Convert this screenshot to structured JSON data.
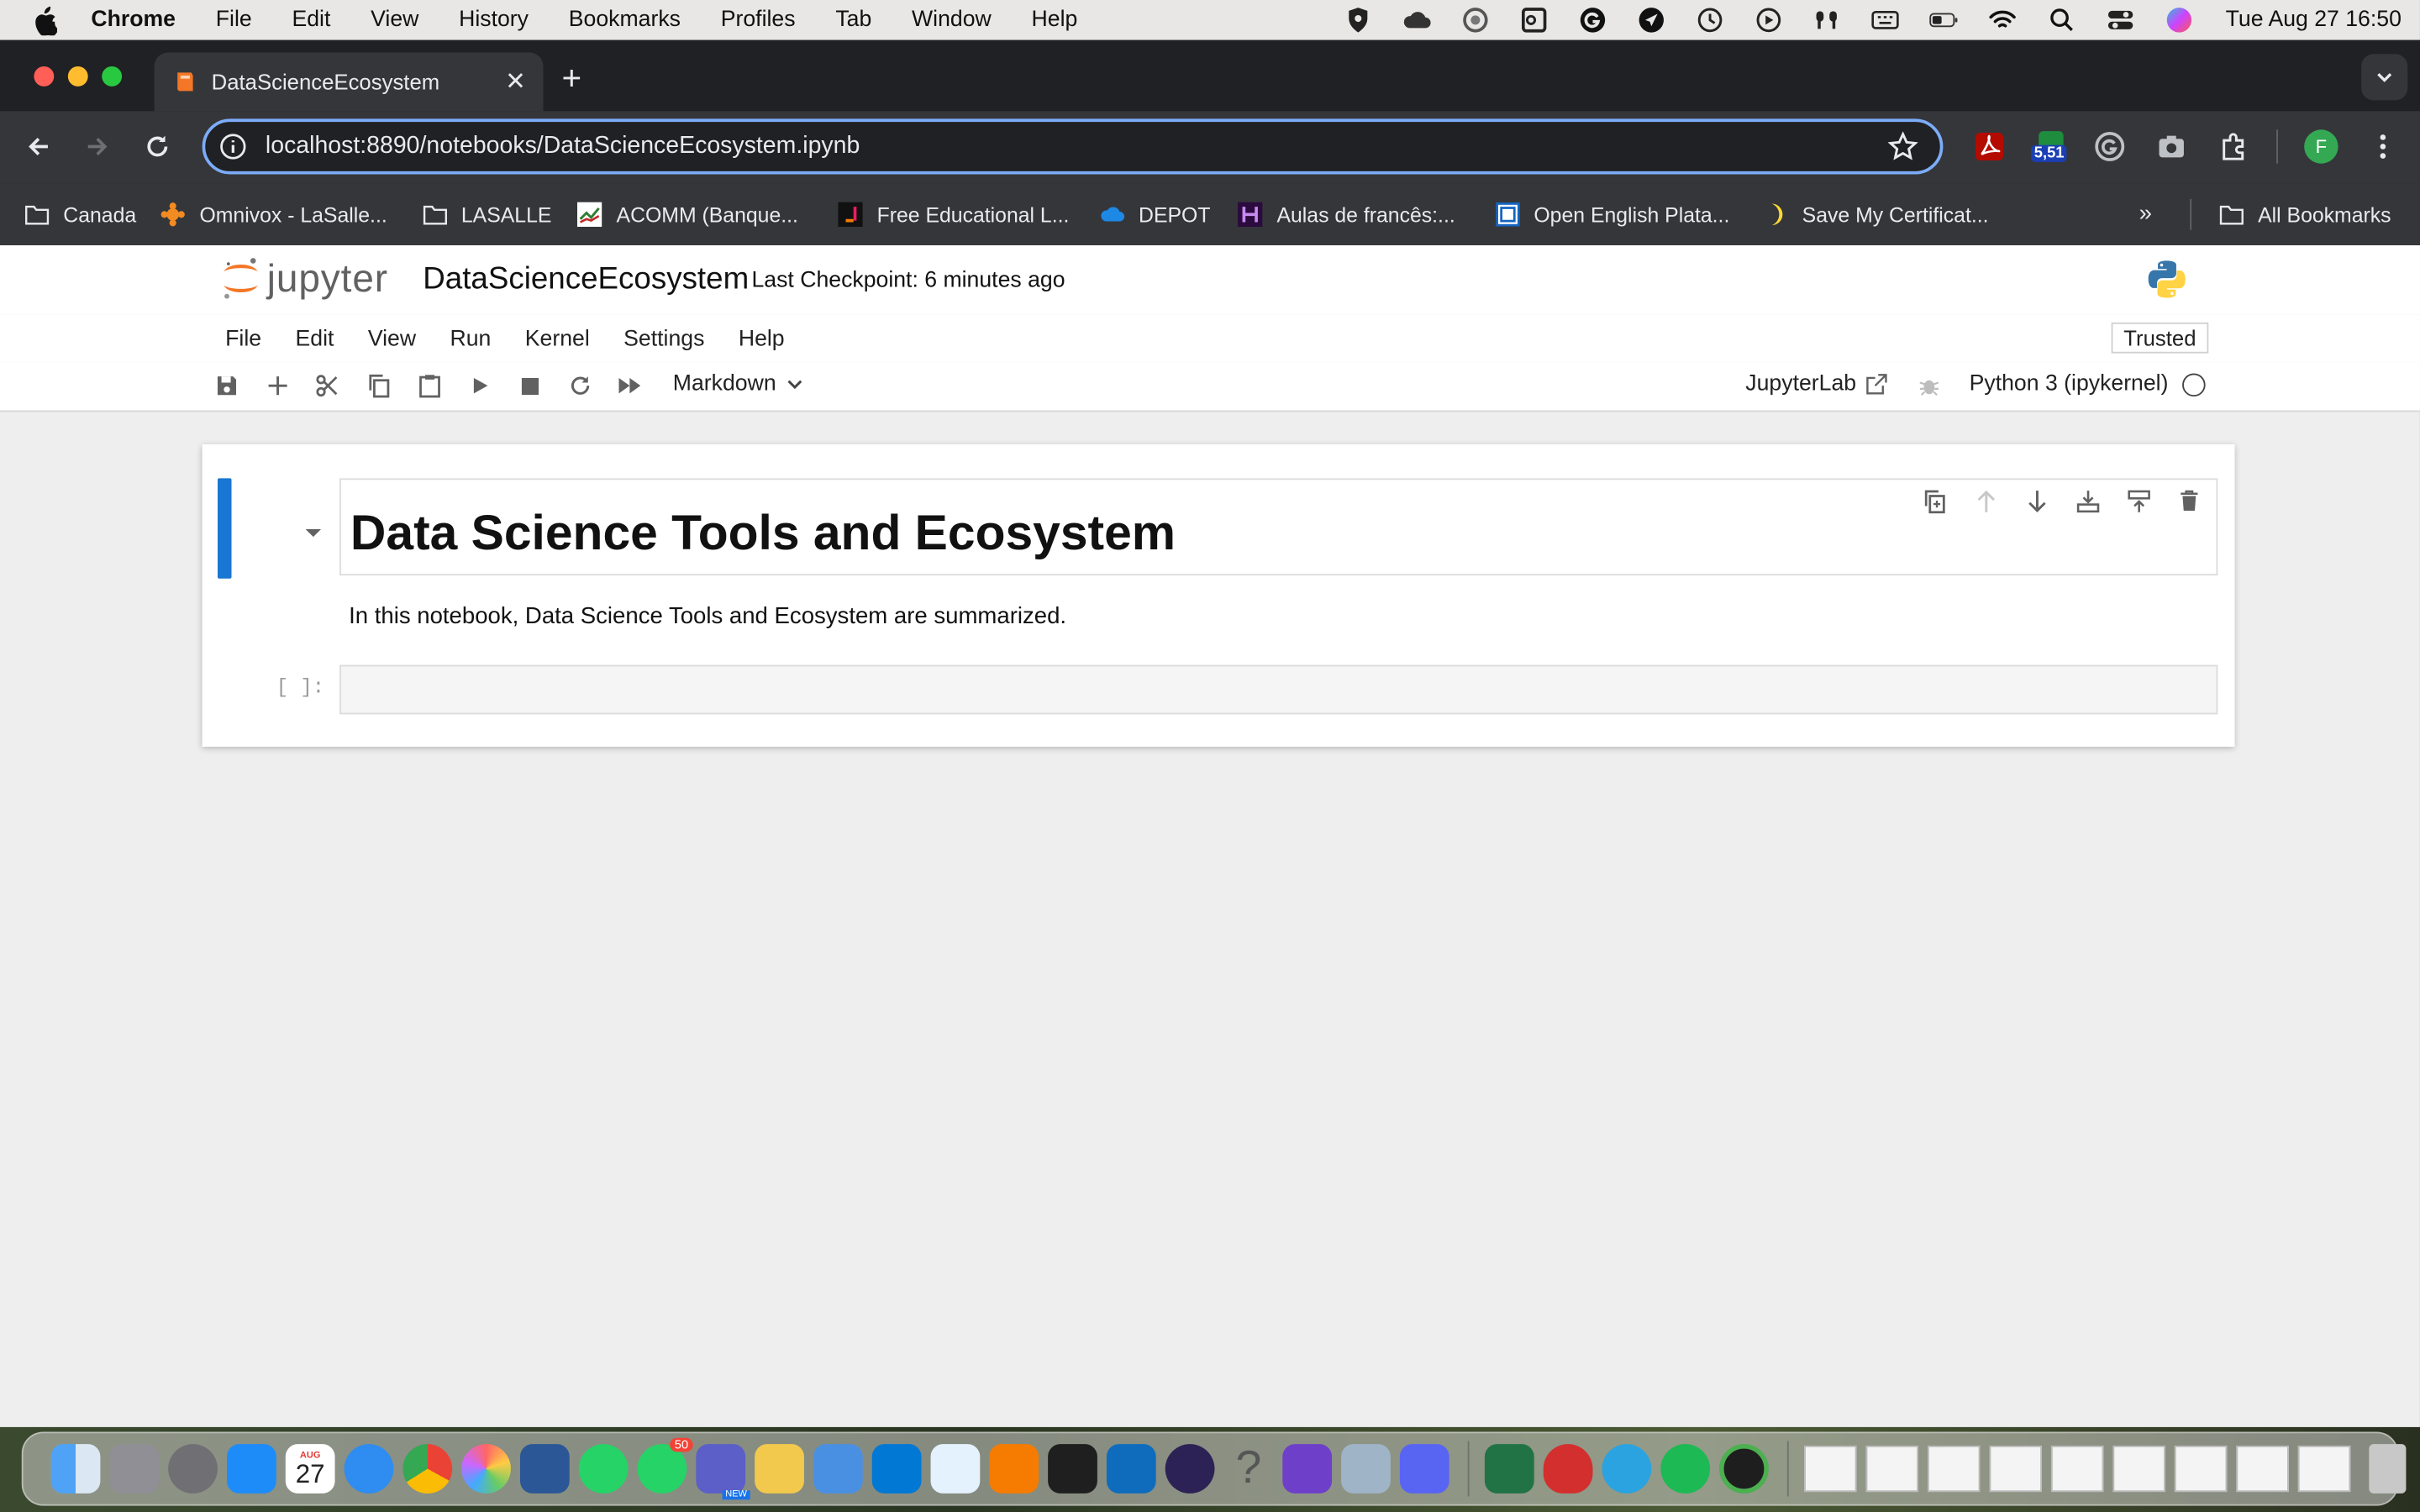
{
  "menubar": {
    "app_name": "Chrome",
    "items": [
      "File",
      "Edit",
      "View",
      "History",
      "Bookmarks",
      "Profiles",
      "Tab",
      "Window",
      "Help"
    ],
    "clock": "Tue Aug 27  16:50"
  },
  "browser": {
    "tab_title": "DataScienceEcosystem",
    "url": "localhost:8890/notebooks/DataScienceEcosystem.ipynb",
    "extension_badge": "5,51",
    "profile_initial": "F",
    "bookmarks": [
      {
        "label": "Canada",
        "icon": "folder-icon"
      },
      {
        "label": "Omnivox - LaSalle...",
        "icon": "omnivox-icon"
      },
      {
        "label": "LASALLE",
        "icon": "folder-icon"
      },
      {
        "label": "ACOMM (Banque...",
        "icon": "chart-icon"
      },
      {
        "label": "Free Educational L...",
        "icon": "edu-icon"
      },
      {
        "label": "DEPOT",
        "icon": "cloud-icon"
      },
      {
        "label": "Aulas de francês:...",
        "icon": "aulas-icon"
      },
      {
        "label": "Open English Plata...",
        "icon": "window-icon"
      },
      {
        "label": "Save My Certificat...",
        "icon": "moon-icon"
      }
    ],
    "all_bookmarks": "All Bookmarks"
  },
  "jupyter": {
    "logo_text": "jupyter",
    "notebook_name": "DataScienceEcosystem",
    "checkpoint": "Last Checkpoint: 6 minutes ago",
    "menu": [
      "File",
      "Edit",
      "View",
      "Run",
      "Kernel",
      "Settings",
      "Help"
    ],
    "trusted": "Trusted",
    "cell_type": "Markdown",
    "jupyterlab_link": "JupyterLab",
    "kernel_name": "Python 3 (ipykernel)"
  },
  "notebook": {
    "heading": "Data Science Tools and Ecosystem",
    "paragraph": "In this notebook, Data Science Tools and Ecosystem are summarized.",
    "code_prompt": "[ ]:"
  },
  "dock": {
    "calendar_month": "AUG",
    "calendar_day": "27",
    "whatsapp_badge": "50",
    "teams_badge": "NEW"
  },
  "colors": {
    "accent_blue": "#1976d2",
    "omnibox_border": "#7cacf8",
    "chrome_dark": "#202124",
    "chrome_toolbar": "#35363a",
    "jupyter_orange": "#f37726"
  }
}
